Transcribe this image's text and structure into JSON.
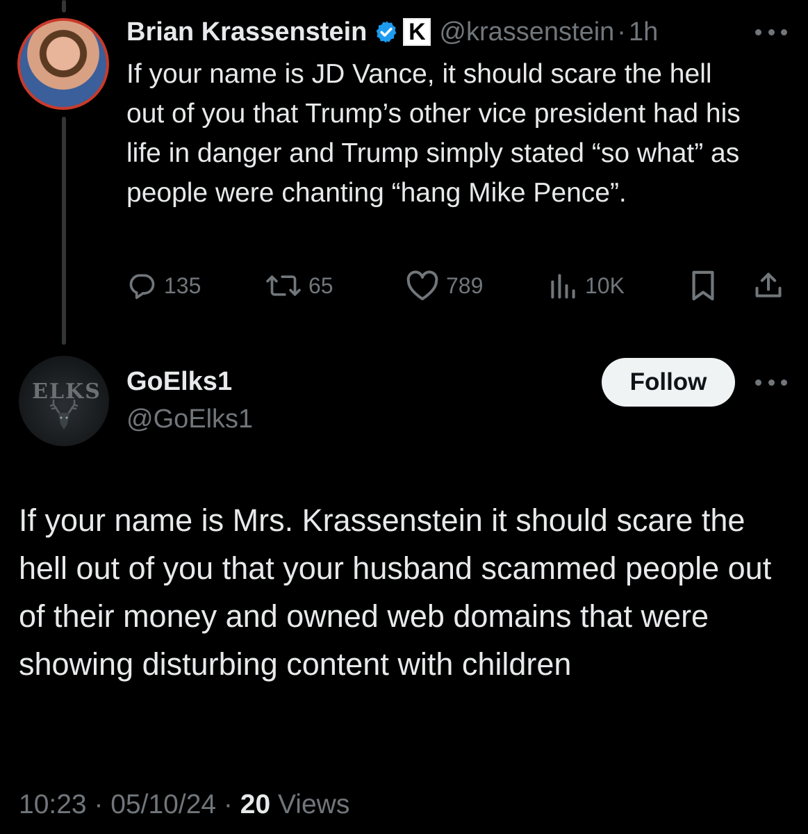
{
  "parent_tweet": {
    "author_name": "Brian Krassenstein",
    "badge_letter": "K",
    "handle": "@krassenstein",
    "separator": "·",
    "time": "1h",
    "text": "If your name is JD Vance, it should scare the hell out of you that Trump’s other vice president had his life in danger and Trump simply stated “so what” as people were chanting “hang Mike Pence”.",
    "actions": {
      "replies": "135",
      "reposts": "65",
      "likes": "789",
      "views": "10K"
    }
  },
  "reply_tweet": {
    "author_name": "GoElks1",
    "handle": "@GoElks1",
    "avatar_text": "ELKS",
    "follow_label": "Follow",
    "text": "If your name is Mrs. Krassenstein it should scare the hell out of you that your husband scammed people out of their money and owned web domains that were showing disturbing content with children",
    "footer": {
      "time": "10:23",
      "sep1": " · ",
      "date": "05/10/24",
      "sep2": " · ",
      "views_count": "20",
      "views_label": " Views"
    }
  },
  "colors": {
    "background": "#000000",
    "text": "#e7e9ea",
    "muted": "#71767b",
    "verified": "#1d9bf0",
    "avatar_ring": "#c93a2a"
  }
}
